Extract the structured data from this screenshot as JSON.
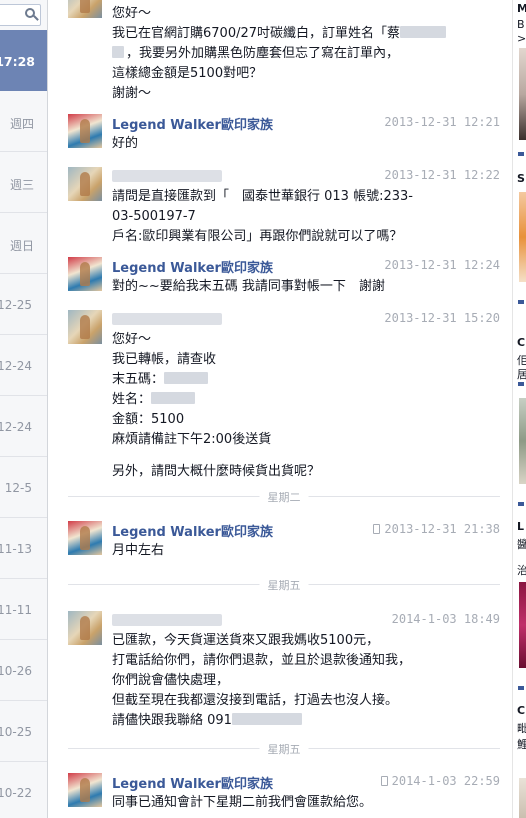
{
  "thread_list": {
    "selected_time": "17:28",
    "items": [
      "週四",
      "週三",
      "週日",
      "12-25",
      "12-24",
      "12-24",
      "12-5",
      "11-13",
      "11-11",
      "10-26",
      "10-25",
      "10-22"
    ]
  },
  "messages": [
    {
      "sender": "",
      "timestamp": "",
      "mobile": false,
      "lines": [
        "您好～",
        "我已在官網訂購6700/27吋碳纖白，訂單姓名「蔡",
        "，我要另外加購黑色防塵套但忘了寫在訂單內，",
        "這樣總金額是5100對吧？",
        "謝謝～"
      ]
    },
    {
      "sender": "Legend Walker歐印家族",
      "timestamp": "2013-12-31 12:21",
      "mobile": false,
      "lines": [
        "好的"
      ]
    },
    {
      "sender": "",
      "timestamp": "2013-12-31 12:22",
      "mobile": false,
      "lines": [
        "請問是直接匯款到「　國泰世華銀行 013 帳號:233-",
        "03-500197-7",
        "戶名:歐印興業有限公司」再跟你們說就可以了嗎？"
      ]
    },
    {
      "sender": "Legend Walker歐印家族",
      "timestamp": "2013-12-31 12:24",
      "mobile": false,
      "lines": [
        "對的~~要給我末五碼 我請同事對帳一下　謝謝"
      ]
    },
    {
      "sender": "",
      "timestamp": "2013-12-31 15:20",
      "mobile": false,
      "lines": [
        "您好～",
        "我已轉帳，請查收",
        "末五碼：",
        "姓名：",
        "金額：5100",
        "麻煩請備註下午2:00後送貨",
        "",
        "另外，請問大概什麼時候貨出貨呢？"
      ]
    },
    {
      "sender": "Legend Walker歐印家族",
      "timestamp": "2013-12-31 21:38",
      "mobile": true,
      "lines": [
        "月中左右"
      ]
    },
    {
      "sender": "",
      "timestamp": "2014-1-03 18:49",
      "mobile": false,
      "lines": [
        "已匯款，今天貨運送貨來又跟我媽收5100元，",
        "打電話給你們，請你們退款，並且於退款後通知我，",
        "你們說會儘快處理，",
        "但截至現在我都還沒接到電話，打過去也沒人接。",
        "請儘快跟我聯絡 091"
      ]
    },
    {
      "sender": "Legend Walker歐印家族",
      "timestamp": "2014-1-03 22:59",
      "mobile": true,
      "lines": [
        "同事已通知會計下星期二前我們會匯款給您。"
      ]
    }
  ],
  "dividers": [
    "星期二",
    "星期五",
    "星期五"
  ],
  "ads": {
    "letters": [
      "M",
      "B",
      ">",
      "S",
      "C",
      "佢",
      "居",
      "L",
      "醬",
      "治",
      "C",
      "毗",
      "鯉"
    ]
  }
}
